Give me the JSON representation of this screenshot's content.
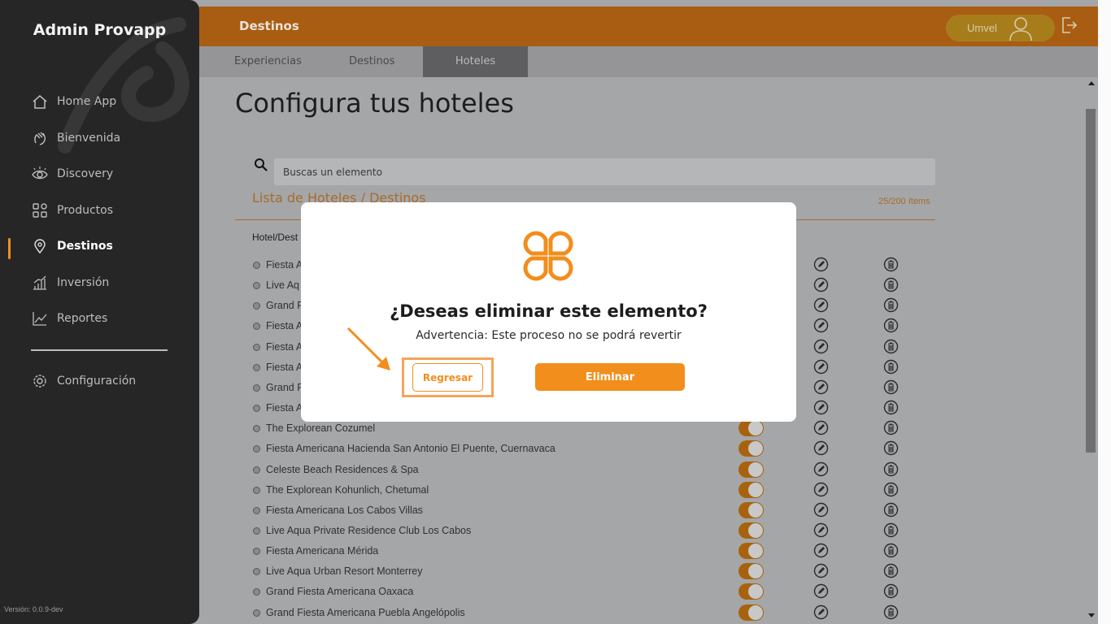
{
  "sidebar": {
    "app_title": "Admin Provapp",
    "items": [
      {
        "label": "Home App",
        "icon": "home-icon"
      },
      {
        "label": "Bienvenida",
        "icon": "hand-wave-icon"
      },
      {
        "label": "Discovery",
        "icon": "eye-icon"
      },
      {
        "label": "Productos",
        "icon": "grid-icon"
      },
      {
        "label": "Destinos",
        "icon": "map-pin-icon",
        "active": true
      },
      {
        "label": "Inversión",
        "icon": "bar-chart-icon"
      },
      {
        "label": "Reportes",
        "icon": "line-chart-icon"
      }
    ],
    "settings_label": "Configuración",
    "version": "Versión: 0.0.9-dev"
  },
  "topbar": {
    "title": "Destinos",
    "user_name": "Umvel"
  },
  "tabs": [
    {
      "label": "Experiencias"
    },
    {
      "label": "Destinos"
    },
    {
      "label": "Hoteles",
      "active": true
    }
  ],
  "main": {
    "page_title": "Configura tus hoteles",
    "search_placeholder": "Buscas un elemento",
    "list_title": "Lista de Hoteles / Destinos",
    "count": "25/200 ítems",
    "column_header": "Hotel/Dest",
    "rows": [
      "Fiesta A",
      "Live Aq",
      "Grand F",
      "Fiesta A",
      "Fiesta A",
      "Fiesta A",
      "Grand F",
      "Fiesta A",
      "The Explorean Cozumel",
      "Fiesta Americana Hacienda San Antonio El Puente, Cuernavaca",
      "Celeste Beach Residences & Spa",
      "The Explorean Kohunlich, Chetumal",
      "Fiesta Americana Los Cabos Villas",
      "Live Aqua Private Residence Club Los Cabos",
      "Fiesta Americana Mérida",
      "Live Aqua Urban Resort Monterrey",
      "Grand Fiesta Americana Oaxaca",
      "Grand Fiesta Americana Puebla Angelópolis"
    ]
  },
  "modal": {
    "title": "¿Deseas eliminar este elemento?",
    "subtitle": "Advertencia: Este proceso no se podrá revertir",
    "back_label": "Regresar",
    "delete_label": "Eliminar"
  },
  "colors": {
    "accent": "#f28e1c",
    "sidebar_bg": "#262626",
    "topbar_bg": "#a95d12"
  }
}
